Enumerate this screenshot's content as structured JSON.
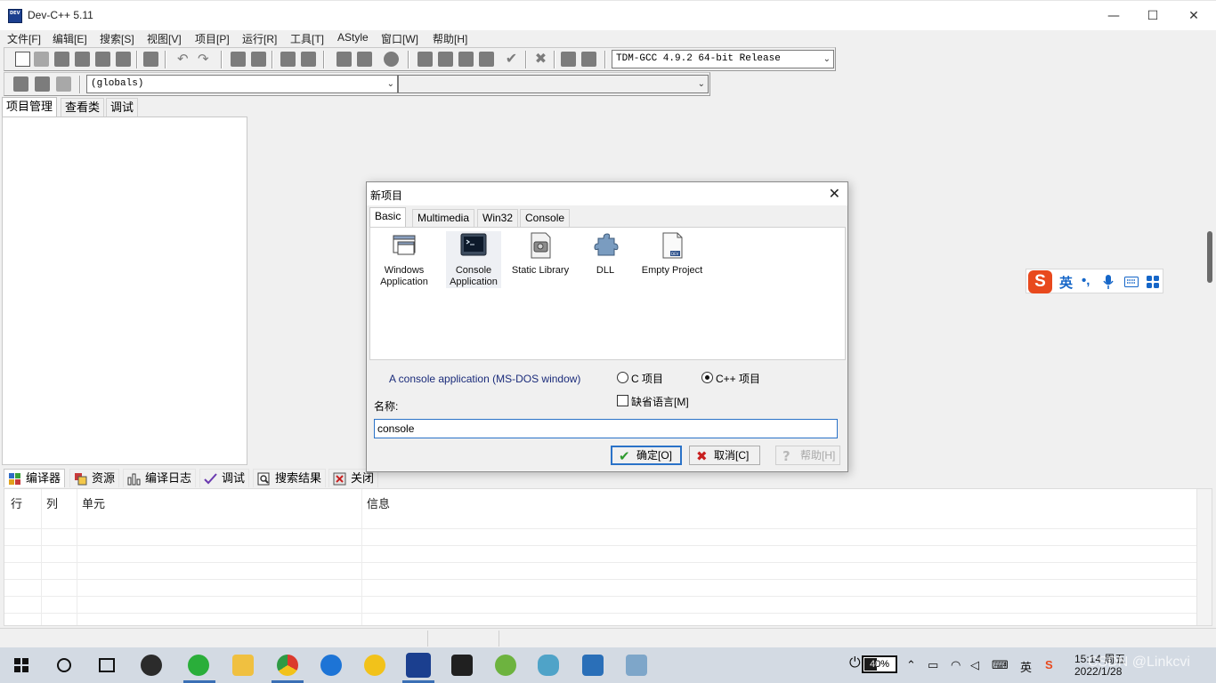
{
  "window": {
    "title": "Dev-C++ 5.11"
  },
  "menu": [
    "文件[F]",
    "编辑[E]",
    "搜索[S]",
    "视图[V]",
    "项目[P]",
    "运行[R]",
    "工具[T]",
    "AStyle",
    "窗口[W]",
    "帮助[H]"
  ],
  "toolbar": {
    "compiler": "TDM-GCC 4.9.2 64-bit Release",
    "scope": "(globals)",
    "symbol": ""
  },
  "left_tabs": [
    "项目管理",
    "查看类",
    "调试"
  ],
  "bottom_tabs": [
    "编译器",
    "资源",
    "编译日志",
    "调试",
    "搜索结果",
    "关闭"
  ],
  "messages": {
    "columns": [
      "行",
      "列",
      "单元",
      "信息"
    ]
  },
  "ime": {
    "lang": "英",
    "punct": "•,",
    "icons": [
      "mic-icon",
      "keyboard-icon",
      "grid-icon"
    ]
  },
  "dialog": {
    "title": "新项目",
    "tabs": [
      "Basic",
      "Multimedia",
      "Win32",
      "Console"
    ],
    "templates": [
      {
        "label1": "Windows",
        "label2": "Application"
      },
      {
        "label1": "Console",
        "label2": "Application"
      },
      {
        "label1": "Static Library",
        "label2": ""
      },
      {
        "label1": "DLL",
        "label2": ""
      },
      {
        "label1": "Empty Project",
        "label2": ""
      }
    ],
    "selected_template": "Console Application",
    "description": "A console application (MS-DOS window)",
    "c_option": "C 项目",
    "cpp_option": "C++ 项目",
    "default_lang": "缺省语言[M]",
    "name_label": "名称:",
    "name_value": "console",
    "ok": "确定[O]",
    "cancel": "取消[C]",
    "help": "帮助[H]"
  },
  "taskbar": {
    "battery": "40%",
    "ime": "英",
    "time": "15:14 周五",
    "date": "2022/1/28"
  },
  "watermark": "CSDN @Linkcvi"
}
